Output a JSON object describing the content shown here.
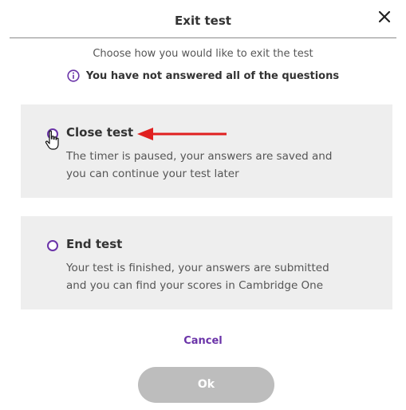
{
  "dialog": {
    "title": "Exit test",
    "subtitle": "Choose how you would like to exit the test",
    "warning": "You have not answered all of the questions",
    "warning_icon": "info-icon",
    "close_icon": "close-icon",
    "accent_color": "#6a33a8"
  },
  "options": [
    {
      "title": "Close test",
      "description_line1": "The timer is paused, your answers are saved and",
      "description_line2": "you can continue your test later",
      "selected": false
    },
    {
      "title": "End test",
      "description_line1": "Your test is finished, your answers are submitted",
      "description_line2": "and you can find your scores in Cambridge One",
      "selected": false
    }
  ],
  "actions": {
    "cancel_label": "Cancel",
    "ok_label": "Ok",
    "ok_enabled": false
  },
  "annotations": {
    "arrow_icon": "red-arrow-icon",
    "cursor_icon": "hand-pointer-icon"
  }
}
